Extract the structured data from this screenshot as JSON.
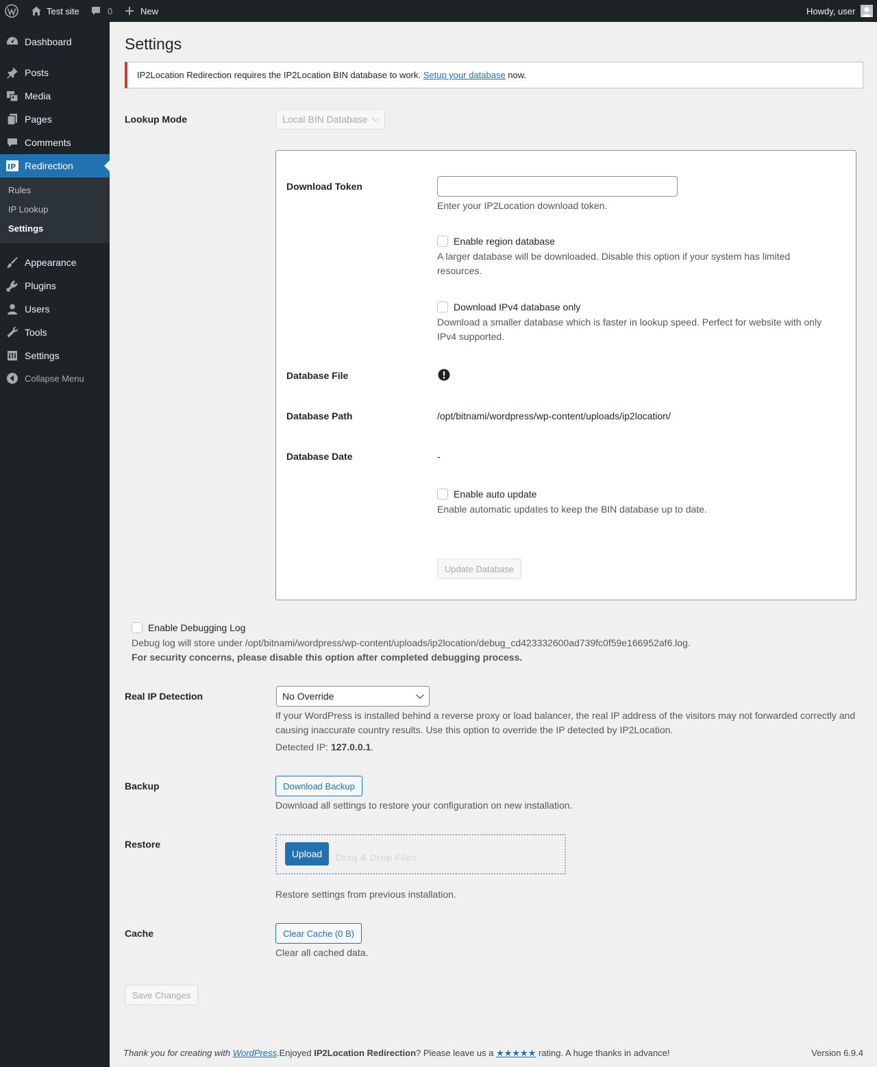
{
  "adminbar": {
    "site_name": "Test site",
    "comments_count": "0",
    "new_label": "New",
    "howdy": "Howdy, user"
  },
  "sidebar": {
    "items": {
      "dashboard": "Dashboard",
      "posts": "Posts",
      "media": "Media",
      "pages": "Pages",
      "comments": "Comments",
      "redirection": "Redirection",
      "appearance": "Appearance",
      "plugins": "Plugins",
      "users": "Users",
      "tools": "Tools",
      "settings": "Settings",
      "collapse": "Collapse Menu"
    },
    "submenu": {
      "rules": "Rules",
      "ip_lookup": "IP Lookup",
      "settings": "Settings"
    },
    "accent_color": "#2271b1"
  },
  "page": {
    "title": "Settings",
    "notice": {
      "text_before": "IP2Location Redirection requires the IP2Location BIN database to work. ",
      "link": "Setup your database",
      "text_after": " now.",
      "border_color": "#d63638"
    },
    "lookup_mode": {
      "label": "Lookup Mode",
      "selected": "Local BIN Database"
    },
    "panel": {
      "download_token_label": "Download Token",
      "download_token_value": "",
      "download_token_desc": "Enter your IP2Location download token.",
      "region_db_label": "Enable region database",
      "region_db_desc": "A larger database will be downloaded. Disable this option if your system has limited resources.",
      "ipv4_label": "Download IPv4 database only",
      "ipv4_desc": "Download a smaller database which is faster in lookup speed. Perfect for website with only IPv4 supported.",
      "db_file_label": "Database File",
      "db_path_label": "Database Path",
      "db_path_value": "/opt/bitnami/wordpress/wp-content/uploads/ip2location/",
      "db_date_label": "Database Date",
      "db_date_value": "-",
      "auto_update_label": "Enable auto update",
      "auto_update_desc": "Enable automatic updates to keep the BIN database up to date.",
      "update_button": "Update Database"
    },
    "debug": {
      "label": "Enable Debugging Log",
      "desc": "Debug log will store under /opt/bitnami/wordpress/wp-content/uploads/ip2location/debug_cd423332600ad739fc0f59e166952af6.log.",
      "warning": "For security concerns, please disable this option after completed debugging process."
    },
    "real_ip": {
      "label": "Real IP Detection",
      "selected": "No Override",
      "desc": "If your WordPress is installed behind a reverse proxy or load balancer, the real IP address of the visitors may not forwarded correctly and causing inaccurate country results. Use this option to override the IP detected by IP2Location.",
      "detected_prefix": "Detected IP: ",
      "detected_ip": "127.0.0.1",
      "detected_suffix": "."
    },
    "backup": {
      "label": "Backup",
      "button": "Download Backup",
      "desc": "Download all settings to restore your configuration on new installation."
    },
    "restore": {
      "label": "Restore",
      "upload_button": "Upload",
      "drop_text": "Drag & Drop Files",
      "desc": "Restore settings from previous installation."
    },
    "cache": {
      "label": "Cache",
      "button": "Clear Cache (0 B)",
      "desc": "Clear all cached data."
    },
    "save_button": "Save Changes"
  },
  "footer": {
    "thank_you": "Thank you for creating with ",
    "wordpress_link": "WordPress",
    "enjoyed": ".Enjoyed ",
    "plugin_name": "IP2Location Redirection",
    "leave": "? Please leave us a ",
    "stars": "★★★★★",
    "rating": " rating. A huge thanks in advance!",
    "version": "Version 6.9.4"
  }
}
